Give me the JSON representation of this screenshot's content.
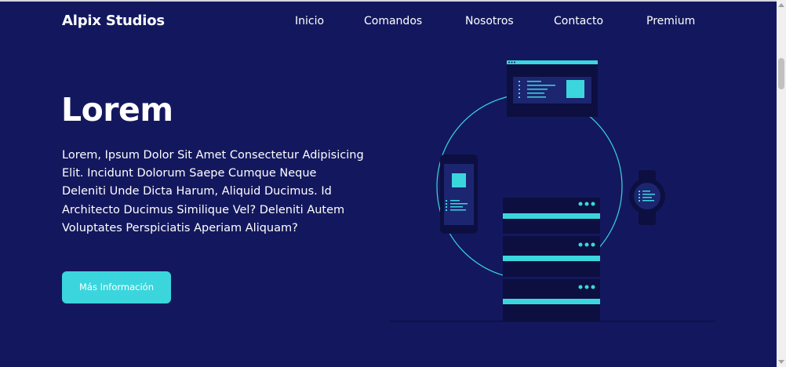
{
  "nav": {
    "brand": "Alpix Studios",
    "links": [
      "Inicio",
      "Comandos",
      "Nosotros",
      "Contacto",
      "Premium"
    ]
  },
  "hero": {
    "title": "Lorem",
    "text": "Lorem, Ipsum Dolor Sit Amet Consectetur Adipisicing Elit. Incidunt Dolorum Saepe Cumque Neque Deleniti Unde Dicta Harum, Aliquid Ducimus. Id Architecto Ducimus Similique Vel? Deleniti Autem Voluptates Perspiciatis Aperiam Aliquam?",
    "button": "Más Información"
  },
  "colors": {
    "background": "#13185e",
    "accent": "#3bd6dd",
    "device_dark": "#0c0f40",
    "device_panel": "#1c2570"
  },
  "illustration": {
    "icons": [
      "browser-window-icon",
      "smartphone-icon",
      "smartwatch-icon",
      "server-rack-icon"
    ]
  }
}
